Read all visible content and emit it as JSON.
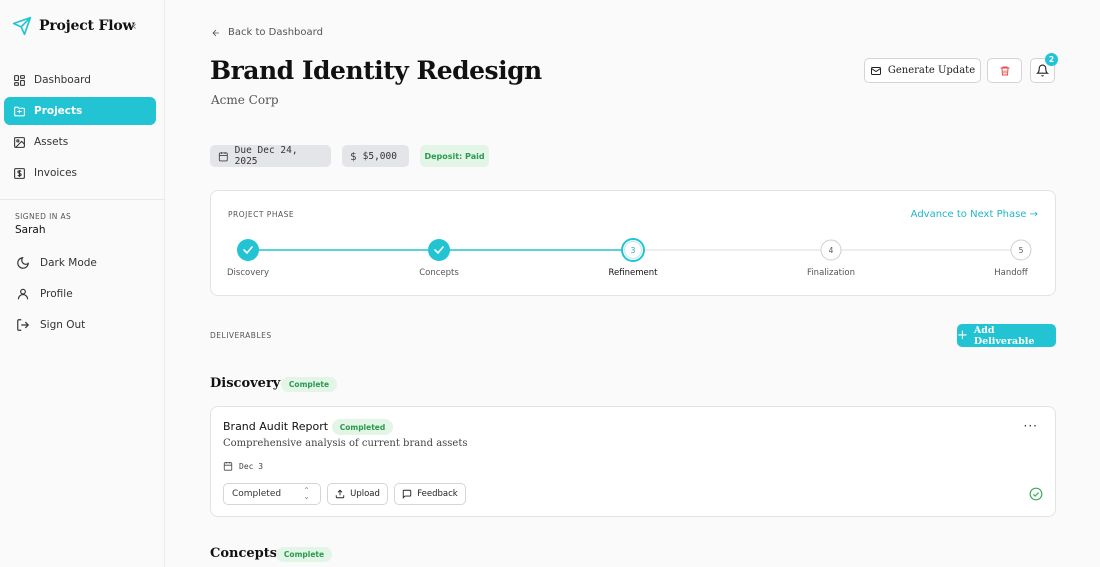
{
  "app": {
    "name": "Project Flow",
    "collapse_icon": "chevron-left-icon"
  },
  "sidebar": {
    "items": [
      {
        "label": "Dashboard",
        "icon": "dashboard-icon",
        "active": false
      },
      {
        "label": "Projects",
        "icon": "folder-icon",
        "active": true
      },
      {
        "label": "Assets",
        "icon": "image-icon",
        "active": false
      },
      {
        "label": "Invoices",
        "icon": "dollar-icon",
        "active": false
      }
    ],
    "signed_in_label": "SIGNED IN AS",
    "user_name": "Sarah",
    "footer_items": [
      {
        "label": "Dark Mode",
        "icon": "moon-icon"
      },
      {
        "label": "Profile",
        "icon": "user-icon"
      },
      {
        "label": "Sign Out",
        "icon": "sign-out-icon"
      }
    ]
  },
  "header": {
    "back_label": "Back to Dashboard",
    "title": "Brand Identity Redesign",
    "client": "Acme Corp",
    "generate_label": "Generate Update",
    "notification_count": "2"
  },
  "meta": {
    "due": "Due Dec 24, 2025",
    "amount": "$5,000",
    "deposit": "Deposit: Paid"
  },
  "phase": {
    "label": "PROJECT PHASE",
    "advance_label": "Advance to Next Phase →",
    "current_index": 2,
    "steps": [
      {
        "label": "Discovery",
        "number": "1",
        "status": "done"
      },
      {
        "label": "Concepts",
        "number": "2",
        "status": "done"
      },
      {
        "label": "Refinement",
        "number": "3",
        "status": "current"
      },
      {
        "label": "Finalization",
        "number": "4",
        "status": "todo"
      },
      {
        "label": "Handoff",
        "number": "5",
        "status": "todo"
      }
    ]
  },
  "deliverables": {
    "label": "DELIVERABLES",
    "add_label": "Add Deliverable",
    "sections": [
      {
        "title": "Discovery",
        "badge": "Complete",
        "items": [
          {
            "title": "Brand Audit Report",
            "status_badge": "Completed",
            "description": "Comprehensive analysis of current brand assets",
            "date": "Dec 3",
            "status_select": "Completed",
            "upload_label": "Upload",
            "feedback_label": "Feedback"
          }
        ]
      },
      {
        "title": "Concepts",
        "badge": "Complete"
      }
    ]
  },
  "colors": {
    "accent": "#22c4d4",
    "success_bg": "#e2f5e7",
    "success_text": "#2a9a4f",
    "danger": "#e24b4b"
  }
}
